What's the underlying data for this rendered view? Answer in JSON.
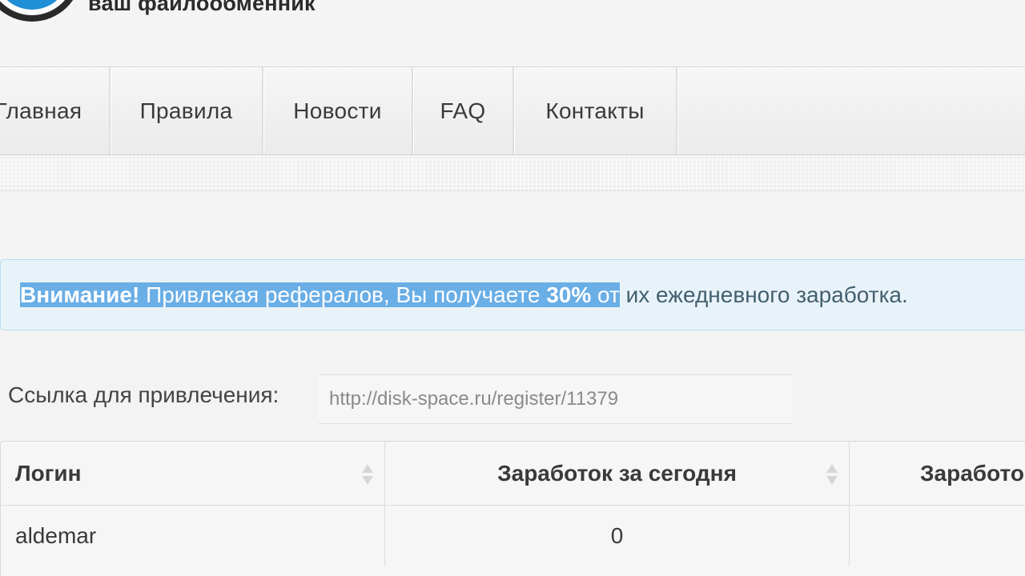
{
  "header": {
    "tagline": "ваш файлообменник"
  },
  "nav": {
    "items": [
      {
        "label": "Главная"
      },
      {
        "label": "Правила"
      },
      {
        "label": "Новости"
      },
      {
        "label": "FAQ"
      },
      {
        "label": "Контакты"
      }
    ]
  },
  "alert": {
    "strong_label": "Внимание!",
    "text_part1": " Привлекая рефералов, Вы получаете ",
    "percent": "30%",
    "text_part2": " от",
    "text_part3": " их ежедневного заработка."
  },
  "referral": {
    "label": "Ссылка для привлечения:",
    "link": "http://disk-space.ru/register/11379"
  },
  "table": {
    "columns": [
      "Логин",
      "Заработок за сегодня",
      "Заработо"
    ],
    "rows": [
      [
        "aldemar",
        "0",
        ""
      ]
    ]
  },
  "colors": {
    "accent_selection": "#6aaee6",
    "alert_bg": "#e8f3f9",
    "alert_border": "#b9dcef"
  }
}
